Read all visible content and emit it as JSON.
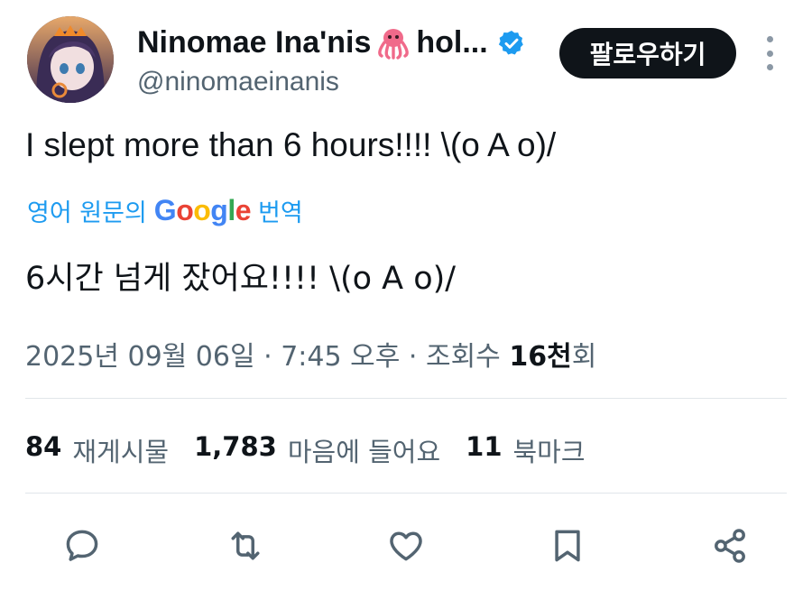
{
  "header": {
    "display_name": "Ninomae Ina'nis",
    "name_suffix": "hol...",
    "handle": "@ninomaeinanis",
    "follow_label": "팔로우하기"
  },
  "tweet": {
    "text": "I slept more than 6 hours!!!! \\(o A o)/",
    "translate_prefix": "영어 원문의",
    "translate_brand": "Google",
    "translate_suffix": "번역",
    "translated_text": "6시간 넘게 잤어요!!!! \\(o A o)/",
    "date": "2025년 09월 06일",
    "time": "7:45 오후",
    "views_prefix": "조회수",
    "views_count": "16천",
    "views_suffix": "회",
    "separator": "·"
  },
  "stats": {
    "reposts_count": "84",
    "reposts_label": "재게시물",
    "likes_count": "1,783",
    "likes_label": "마음에 들어요",
    "bookmarks_count": "11",
    "bookmarks_label": "북마크"
  },
  "icons": {
    "reply": "reply-icon",
    "repost": "repost-icon",
    "like": "heart-icon",
    "bookmark": "bookmark-icon",
    "share": "share-icon",
    "verified": "verified-badge-icon",
    "emoji": "octopus-emoji-icon"
  },
  "colors": {
    "accent": "#1d9bf0",
    "text_primary": "#0f1419",
    "text_secondary": "#536471",
    "icon": "#536471",
    "follow_bg": "#0f1419"
  }
}
